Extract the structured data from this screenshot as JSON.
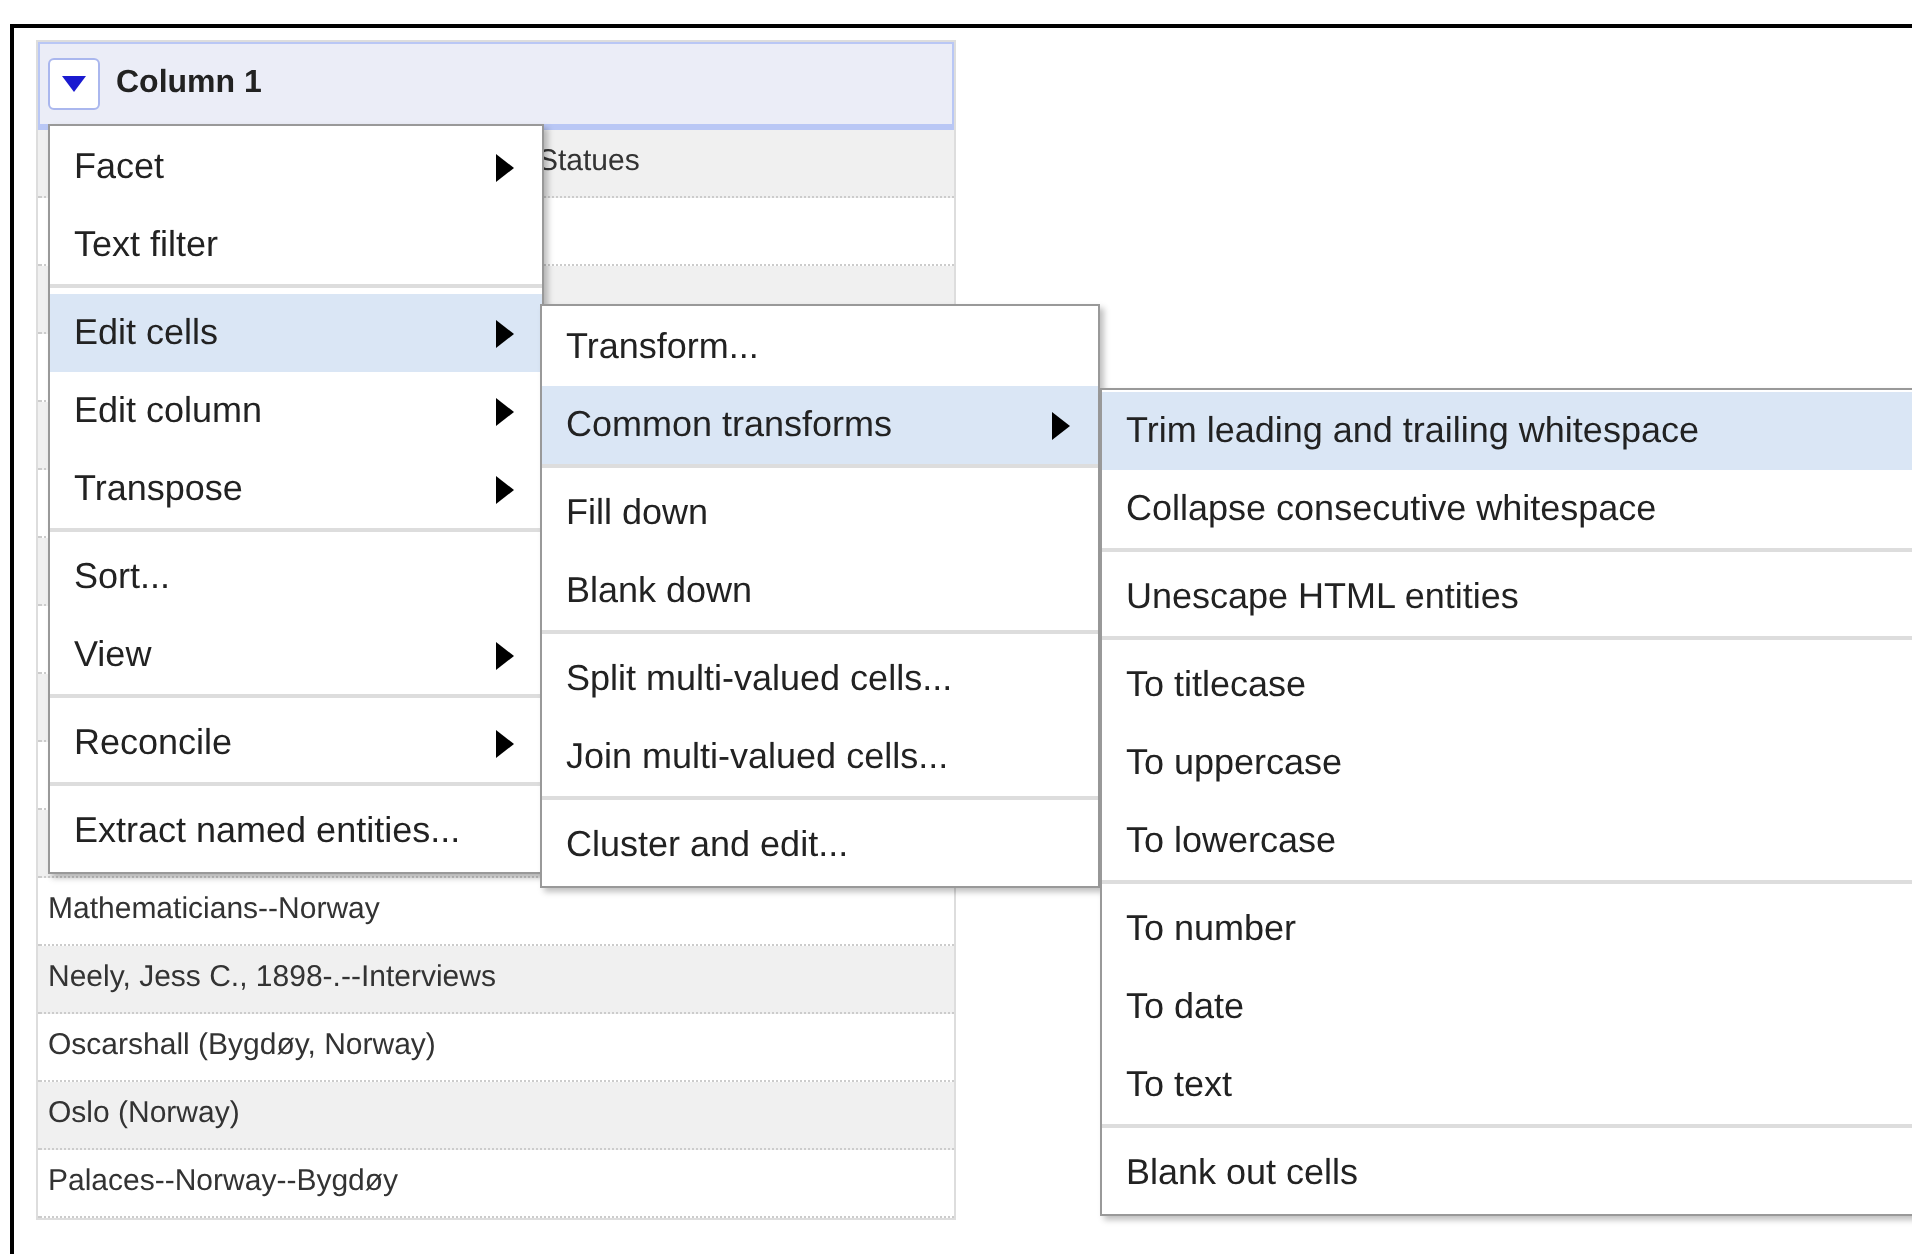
{
  "table": {
    "column": {
      "title": "Column 1"
    },
    "rows_top": [
      "Statues"
    ],
    "rows_bottom": [
      "Mathematicians--Norway",
      "Neely, Jess C., 1898-.--Interviews",
      "Oscarshall (Bygdøy, Norway)",
      "Oslo (Norway)",
      "Palaces--Norway--Bygdøy"
    ]
  },
  "menus": [
    {
      "groups": [
        [
          {
            "label": "Facet",
            "selected": false,
            "has_submenu": true
          },
          {
            "label": "Text filter",
            "selected": false,
            "has_submenu": false
          }
        ],
        [
          {
            "label": "Edit cells",
            "selected": true,
            "has_submenu": true
          },
          {
            "label": "Edit column",
            "selected": false,
            "has_submenu": true
          },
          {
            "label": "Transpose",
            "selected": false,
            "has_submenu": true
          }
        ],
        [
          {
            "label": "Sort...",
            "selected": false,
            "has_submenu": false
          },
          {
            "label": "View",
            "selected": false,
            "has_submenu": true
          }
        ],
        [
          {
            "label": "Reconcile",
            "selected": false,
            "has_submenu": true
          }
        ],
        [
          {
            "label": "Extract named entities...",
            "selected": false,
            "has_submenu": false
          }
        ]
      ]
    },
    {
      "groups": [
        [
          {
            "label": "Transform...",
            "selected": false,
            "has_submenu": false
          },
          {
            "label": "Common transforms",
            "selected": true,
            "has_submenu": true
          }
        ],
        [
          {
            "label": "Fill down",
            "selected": false,
            "has_submenu": false
          },
          {
            "label": "Blank down",
            "selected": false,
            "has_submenu": false
          }
        ],
        [
          {
            "label": "Split multi-valued cells...",
            "selected": false,
            "has_submenu": false
          },
          {
            "label": "Join multi-valued cells...",
            "selected": false,
            "has_submenu": false
          }
        ],
        [
          {
            "label": "Cluster and edit...",
            "selected": false,
            "has_submenu": false
          }
        ]
      ]
    },
    {
      "groups": [
        [
          {
            "label": "Trim leading and trailing whitespace",
            "selected": true,
            "has_submenu": false
          },
          {
            "label": "Collapse consecutive whitespace",
            "selected": false,
            "has_submenu": false
          }
        ],
        [
          {
            "label": "Unescape HTML entities",
            "selected": false,
            "has_submenu": false
          }
        ],
        [
          {
            "label": "To titlecase",
            "selected": false,
            "has_submenu": false
          },
          {
            "label": "To uppercase",
            "selected": false,
            "has_submenu": false
          },
          {
            "label": "To lowercase",
            "selected": false,
            "has_submenu": false
          }
        ],
        [
          {
            "label": "To number",
            "selected": false,
            "has_submenu": false
          },
          {
            "label": "To date",
            "selected": false,
            "has_submenu": false
          },
          {
            "label": "To text",
            "selected": false,
            "has_submenu": false
          }
        ],
        [
          {
            "label": "Blank out cells",
            "selected": false,
            "has_submenu": false
          }
        ]
      ]
    }
  ]
}
